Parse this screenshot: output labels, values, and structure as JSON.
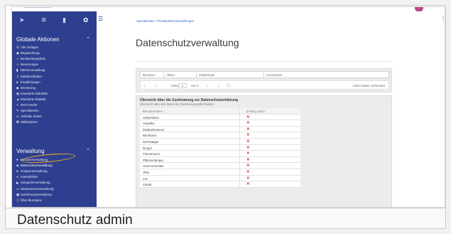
{
  "sidebar": {
    "top_icons": [
      "paper-plane-icon",
      "puzzle-icon",
      "clipboard-icon",
      "gear-icon"
    ],
    "sections": [
      {
        "title": "Globale Aktionen",
        "items": [
          {
            "label": "Alle Vorlagen",
            "icon": "list-icon"
          },
          {
            "label": "Begutachtung",
            "icon": "eye-icon"
          },
          {
            "label": "Beobachtungsliste",
            "icon": "star-icon"
          },
          {
            "label": "Bewertungen",
            "icon": "star-icon"
          },
          {
            "label": "Bücherverwaltung",
            "icon": "book-icon"
          },
          {
            "label": "Dateihochladen",
            "icon": "upload-icon"
          },
          {
            "label": "Empfehlungen",
            "icon": "thumb-icon"
          },
          {
            "label": "Erinnerung",
            "icon": "bell-icon"
          },
          {
            "label": "Erweiterte Dateiliste",
            "icon": "file-icon"
          },
          {
            "label": "Erweiterte Statistik",
            "icon": "chart-icon"
          },
          {
            "label": "RSS Feeder",
            "icon": "rss-icon"
          },
          {
            "label": "Spezialseiten",
            "icon": "wand-icon"
          },
          {
            "label": "Verlinkte Seiten",
            "icon": "link-icon"
          },
          {
            "label": "WikiExplorer",
            "icon": "compass-icon"
          }
        ]
      },
      {
        "title": "Verwaltung",
        "items": [
          {
            "label": "Benutzerverwaltung",
            "icon": "user-icon"
          },
          {
            "label": "Datenschutzverwaltung",
            "icon": "shield-icon",
            "active": true
          },
          {
            "label": "Gruppenverwaltung",
            "icon": "group-icon"
          },
          {
            "label": "Interwikilinks",
            "icon": "link-icon"
          },
          {
            "label": "Kategorienverwaltung",
            "icon": "tag-icon"
          },
          {
            "label": "Namensraumverwaltung",
            "icon": "folder-icon"
          },
          {
            "label": "Zuordnungsverwaltung",
            "icon": "grid-icon"
          },
          {
            "label": "Über BlueSpice",
            "icon": "info-icon"
          }
        ]
      }
    ]
  },
  "breadcrumb": {
    "items": [
      "Spezialseiten",
      "Privatsphäreneinstellungen"
    ],
    "separator": "/"
  },
  "page_title": "Datenschutzverwaltung",
  "search_grid": {
    "columns": [
      "Benutzer",
      "Aktion",
      "Zeitstempel",
      "Kommentar"
    ],
    "pager": {
      "page_label": "Seite",
      "page_value": "1",
      "of_label": "von 0",
      "empty_text": "Keine Daten vorhanden"
    }
  },
  "consent": {
    "title": "Übersicht über die Zustimmung zur Datenschutzerklärung",
    "subtitle": "Übersicht über den Stand der Zustimmung aller Nutzer",
    "col_user": "Benutzername ↑",
    "col_policy": "privacy policy",
    "rows": [
      {
        "user": "Aebersbach",
        "value": "✕"
      },
      {
        "user": "Angelika",
        "value": "✕"
      },
      {
        "user": "BSMaintenance",
        "value": "✕"
      },
      {
        "user": "Bhofmann",
        "value": "✕"
      },
      {
        "user": "Dschwalger",
        "value": "✕"
      },
      {
        "user": "Drogel",
        "value": "✕"
      },
      {
        "user": "Ffoerstmann",
        "value": "✕"
      },
      {
        "user": "Pflanzenberger",
        "value": "✕"
      },
      {
        "user": "Horst Schreiber",
        "value": "✕"
      },
      {
        "user": "JRar",
        "value": "✕"
      },
      {
        "user": "Lex",
        "value": "✕"
      },
      {
        "user": "Lärata",
        "value": "✕"
      }
    ]
  },
  "caption": "Datenschutz admin",
  "colors": {
    "sidebar_bg": "#2f3f8f",
    "highlight": "#f2b21b",
    "cross": "#d32f2f",
    "link": "#3366cc"
  }
}
